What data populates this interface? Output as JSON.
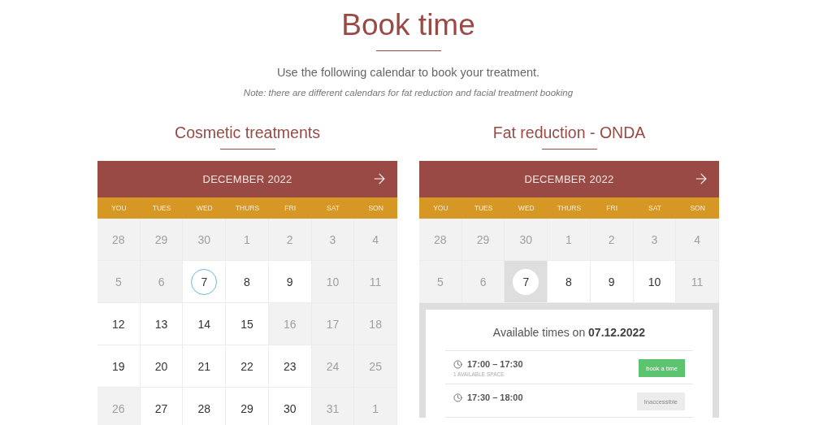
{
  "title": "Book time",
  "intro": "Use the following calendar to book your treatment.",
  "note": "Note: there are different calendars for fat reduction and facial treatment booking",
  "calendars": [
    {
      "title": "Cosmetic treatments",
      "month": "DECEMBER 2022",
      "weekdays": [
        "YOU",
        "TUES",
        "WED",
        "THURS",
        "FRI",
        "SAT",
        "SON"
      ],
      "weeks": [
        [
          {
            "day": "28",
            "available": false,
            "selected": false,
            "today": false
          },
          {
            "day": "29",
            "available": false,
            "selected": false,
            "today": false
          },
          {
            "day": "30",
            "available": false,
            "selected": false,
            "today": false
          },
          {
            "day": "1",
            "available": false,
            "selected": false,
            "today": false
          },
          {
            "day": "2",
            "available": false,
            "selected": false,
            "today": false
          },
          {
            "day": "3",
            "available": false,
            "selected": false,
            "today": false
          },
          {
            "day": "4",
            "available": false,
            "selected": false,
            "today": false
          }
        ],
        [
          {
            "day": "5",
            "available": false,
            "selected": false,
            "today": false
          },
          {
            "day": "6",
            "available": false,
            "selected": false,
            "today": false
          },
          {
            "day": "7",
            "available": true,
            "selected": false,
            "today": true
          },
          {
            "day": "8",
            "available": true,
            "selected": false,
            "today": false
          },
          {
            "day": "9",
            "available": true,
            "selected": false,
            "today": false
          },
          {
            "day": "10",
            "available": false,
            "selected": false,
            "today": false
          },
          {
            "day": "11",
            "available": false,
            "selected": false,
            "today": false
          }
        ],
        [
          {
            "day": "12",
            "available": true,
            "selected": false,
            "today": false
          },
          {
            "day": "13",
            "available": true,
            "selected": false,
            "today": false
          },
          {
            "day": "14",
            "available": true,
            "selected": false,
            "today": false
          },
          {
            "day": "15",
            "available": true,
            "selected": false,
            "today": false
          },
          {
            "day": "16",
            "available": false,
            "selected": false,
            "today": false
          },
          {
            "day": "17",
            "available": false,
            "selected": false,
            "today": false
          },
          {
            "day": "18",
            "available": false,
            "selected": false,
            "today": false
          }
        ],
        [
          {
            "day": "19",
            "available": true,
            "selected": false,
            "today": false
          },
          {
            "day": "20",
            "available": true,
            "selected": false,
            "today": false
          },
          {
            "day": "21",
            "available": true,
            "selected": false,
            "today": false
          },
          {
            "day": "22",
            "available": true,
            "selected": false,
            "today": false
          },
          {
            "day": "23",
            "available": true,
            "selected": false,
            "today": false
          },
          {
            "day": "24",
            "available": false,
            "selected": false,
            "today": false
          },
          {
            "day": "25",
            "available": false,
            "selected": false,
            "today": false
          }
        ],
        [
          {
            "day": "26",
            "available": false,
            "selected": false,
            "today": false
          },
          {
            "day": "27",
            "available": true,
            "selected": false,
            "today": false
          },
          {
            "day": "28",
            "available": true,
            "selected": false,
            "today": false
          },
          {
            "day": "29",
            "available": true,
            "selected": false,
            "today": false
          },
          {
            "day": "30",
            "available": true,
            "selected": false,
            "today": false
          },
          {
            "day": "31",
            "available": false,
            "selected": false,
            "today": false
          },
          {
            "day": "1",
            "available": false,
            "selected": false,
            "today": false
          }
        ]
      ]
    },
    {
      "title": "Fat reduction - ONDA",
      "month": "DECEMBER 2022",
      "weekdays": [
        "YOU",
        "TUES",
        "WED",
        "THURS",
        "FRI",
        "SAT",
        "SON"
      ],
      "weeks": [
        [
          {
            "day": "28",
            "available": false,
            "selected": false,
            "today": false
          },
          {
            "day": "29",
            "available": false,
            "selected": false,
            "today": false
          },
          {
            "day": "30",
            "available": false,
            "selected": false,
            "today": false
          },
          {
            "day": "1",
            "available": false,
            "selected": false,
            "today": false
          },
          {
            "day": "2",
            "available": false,
            "selected": false,
            "today": false
          },
          {
            "day": "3",
            "available": false,
            "selected": false,
            "today": false
          },
          {
            "day": "4",
            "available": false,
            "selected": false,
            "today": false
          }
        ],
        [
          {
            "day": "5",
            "available": false,
            "selected": false,
            "today": false
          },
          {
            "day": "6",
            "available": false,
            "selected": false,
            "today": false
          },
          {
            "day": "7",
            "available": true,
            "selected": true,
            "today": false
          },
          {
            "day": "8",
            "available": true,
            "selected": false,
            "today": false
          },
          {
            "day": "9",
            "available": true,
            "selected": false,
            "today": false
          },
          {
            "day": "10",
            "available": true,
            "selected": false,
            "today": false
          },
          {
            "day": "11",
            "available": false,
            "selected": false,
            "today": false
          }
        ]
      ],
      "times": {
        "heading": "Available times on **07.12.2022**",
        "slots": [
          {
            "time": "17:00 – 17:30",
            "note": "1 AVAILABLE SPACE",
            "button": "book a time",
            "enabled": true
          },
          {
            "time": "17:30 – 18:00",
            "button": "Inaccessible",
            "enabled": false
          }
        ]
      }
    }
  ]
}
